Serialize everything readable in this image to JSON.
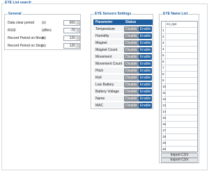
{
  "panel": {
    "title": "EYE List search"
  },
  "general": {
    "title": "General",
    "rows": [
      {
        "label": "Data clear period",
        "unit": "(s)",
        "value": "600"
      },
      {
        "label": "RSSI",
        "unit": "(dBm)",
        "value": "-70"
      },
      {
        "label": "Record Period on Move",
        "unit": "(s)",
        "value": "120"
      },
      {
        "label": "Record Period on Stop",
        "unit": "(s)",
        "value": "120"
      }
    ]
  },
  "sensors": {
    "title": "EYE Sensors Settings",
    "header": {
      "parameter": "Parameter",
      "status": "Status"
    },
    "disable_label": "Disable",
    "enable_label": "Enable",
    "rows": [
      "Temperature",
      "Humidity",
      "Magnet",
      "Magnet Count",
      "Movement",
      "Movement Count",
      "Pitch",
      "Roll",
      "Low Battery",
      "Battery Voltage",
      "Name",
      "MAC"
    ]
  },
  "namelist": {
    "title": "EYE Name List",
    "column_header": "mi_eye",
    "row_numbers": [
      "1",
      "2",
      "3",
      "4",
      "5",
      "6",
      "7",
      "8",
      "9",
      "10",
      "11",
      "12",
      "13",
      "14",
      "15",
      "16",
      "17",
      "18",
      "19",
      "20"
    ],
    "import_label": "Import CSV",
    "export_label": "Export CSV"
  },
  "colors": {
    "accent": "#1f5f9f",
    "disabled": "#8a9097",
    "border": "#c4c8cc"
  }
}
